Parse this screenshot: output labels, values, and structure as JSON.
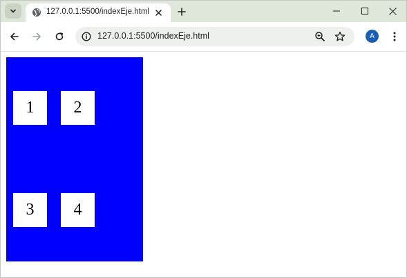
{
  "browser": {
    "tab": {
      "title": "127.0.0.1:5500/indexEje.html",
      "favicon": "globe-icon"
    },
    "address_bar": {
      "url": "127.0.0.1:5500/indexEje.html"
    },
    "profile": {
      "initial": "A",
      "color": "#1a5fb4"
    }
  },
  "page": {
    "container_color": "#0000ff",
    "boxes": [
      {
        "label": "1"
      },
      {
        "label": "2"
      },
      {
        "label": "3"
      },
      {
        "label": "4"
      }
    ]
  }
}
